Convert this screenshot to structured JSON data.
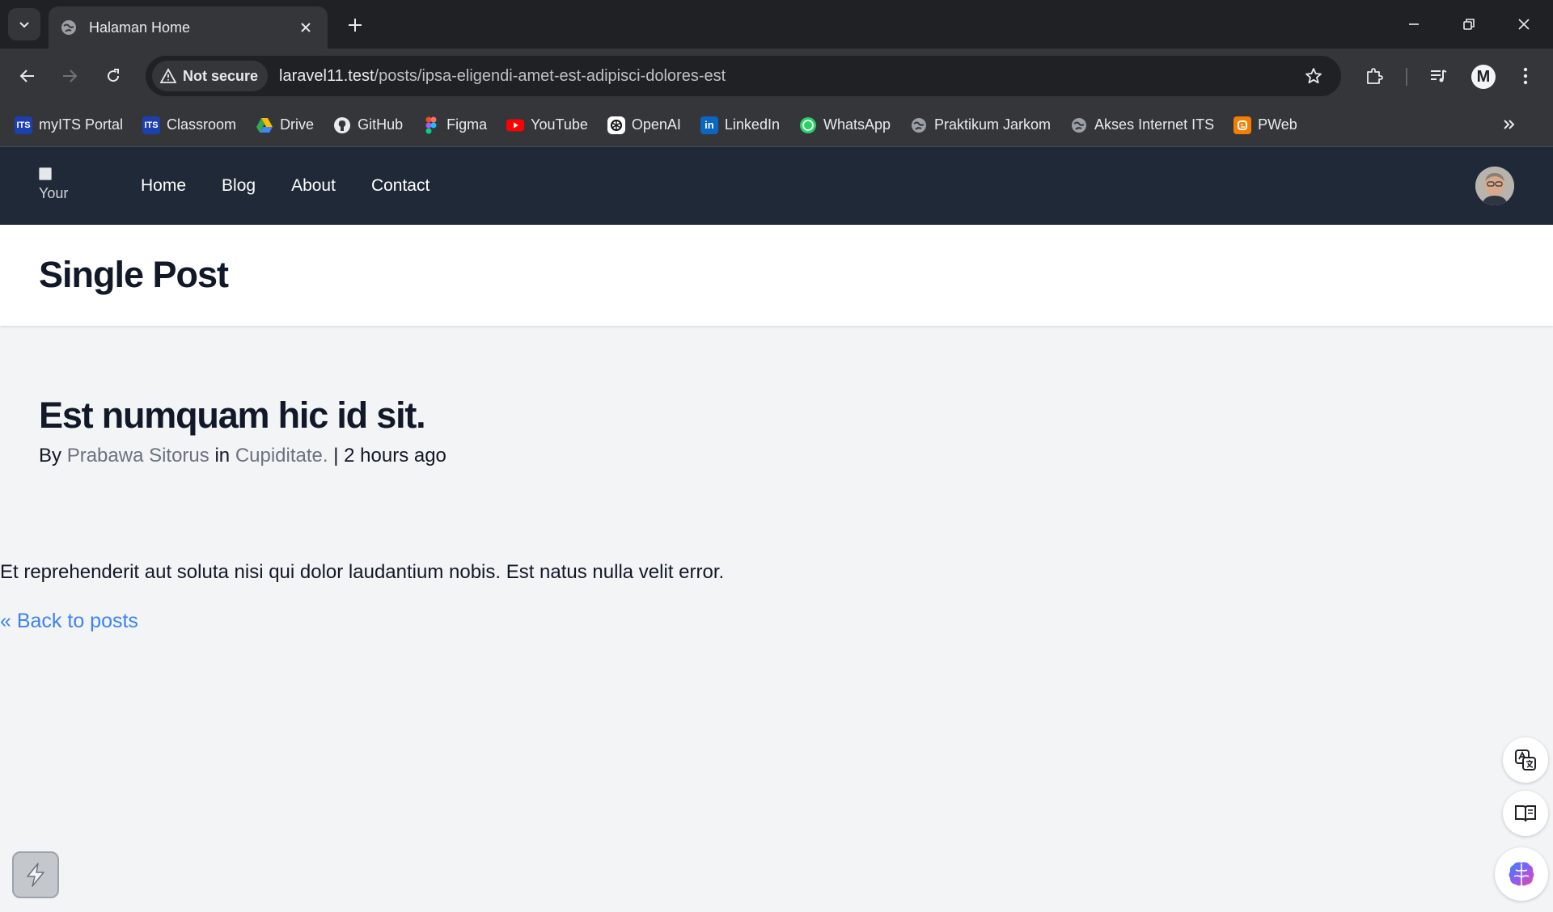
{
  "browser": {
    "tab": {
      "title": "Halaman Home",
      "favicon": "globe-icon"
    },
    "security_label": "Not secure",
    "url_host": "laravel11.test",
    "url_path": "/posts/ipsa-eligendi-amet-est-adipisci-dolores-est",
    "profile_initial": "M",
    "bookmarks": [
      {
        "label": "myITS Portal",
        "icon": "its-icon"
      },
      {
        "label": "Classroom",
        "icon": "its-icon"
      },
      {
        "label": "Drive",
        "icon": "drive-icon"
      },
      {
        "label": "GitHub",
        "icon": "github-icon"
      },
      {
        "label": "Figma",
        "icon": "figma-icon"
      },
      {
        "label": "YouTube",
        "icon": "youtube-icon"
      },
      {
        "label": "OpenAI",
        "icon": "openai-icon"
      },
      {
        "label": "LinkedIn",
        "icon": "linkedin-icon"
      },
      {
        "label": "WhatsApp",
        "icon": "whatsapp-icon"
      },
      {
        "label": "Praktikum Jarkom",
        "icon": "globe-icon"
      },
      {
        "label": "Akses Internet ITS",
        "icon": "globe-icon"
      },
      {
        "label": "PWeb",
        "icon": "blogger-icon"
      }
    ]
  },
  "site": {
    "logo_alt": "Your Company",
    "nav": [
      "Home",
      "Blog",
      "About",
      "Contact"
    ]
  },
  "page": {
    "title": "Single Post"
  },
  "post": {
    "title": "Est numquam hic id sit.",
    "by": "By",
    "author": "Prabawa Sitorus",
    "in": "in",
    "category": "Cupiditate.",
    "separator": "|",
    "time": "2 hours ago",
    "body": "Et reprehenderit aut soluta nisi qui dolor laudantium nobis. Est natus nulla velit error.",
    "back_link": "« Back to posts"
  },
  "colors": {
    "nav_bg": "#1f2937",
    "page_bg": "#f3f4f6",
    "link_blue": "#3b82f6",
    "meta_gray": "#6b7280"
  }
}
